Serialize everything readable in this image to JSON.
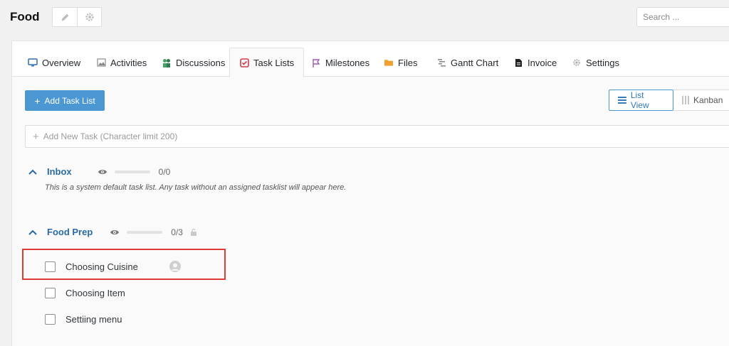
{
  "header": {
    "project_title": "Food",
    "search_placeholder": "Search ..."
  },
  "tabs": [
    {
      "label": "Overview",
      "icon": "monitor-icon"
    },
    {
      "label": "Activities",
      "icon": "image-icon"
    },
    {
      "label": "Discussions",
      "icon": "people-icon"
    },
    {
      "label": "Task Lists",
      "icon": "checkbox-icon",
      "active": true
    },
    {
      "label": "Milestones",
      "icon": "flag-icon"
    },
    {
      "label": "Files",
      "icon": "folder-icon"
    },
    {
      "label": "Gantt Chart",
      "icon": "gantt-icon"
    },
    {
      "label": "Invoice",
      "icon": "document-icon"
    },
    {
      "label": "Settings",
      "icon": "gear-icon"
    }
  ],
  "toolbar": {
    "add_task_list": "Add Task List",
    "list_view": "List View",
    "kanban": "Kanban"
  },
  "new_task": {
    "placeholder": "Add New Task (Character limit 200)"
  },
  "task_lists": [
    {
      "title": "Inbox",
      "count": "0/0",
      "progress": 0,
      "description": "This is a system default task list. Any task without an assigned tasklist will appear here."
    },
    {
      "title": "Food Prep",
      "count": "0/3",
      "progress": 0,
      "tasks": [
        {
          "title": "Choosing Cuisine",
          "checked": false,
          "has_assignee": true
        },
        {
          "title": "Choosing Item",
          "checked": false
        },
        {
          "title": "Settiing menu",
          "checked": false
        }
      ]
    }
  ],
  "colors": {
    "primary": "#4a97d2",
    "list_title": "#2a6aa0",
    "highlight": "#e03b32"
  }
}
